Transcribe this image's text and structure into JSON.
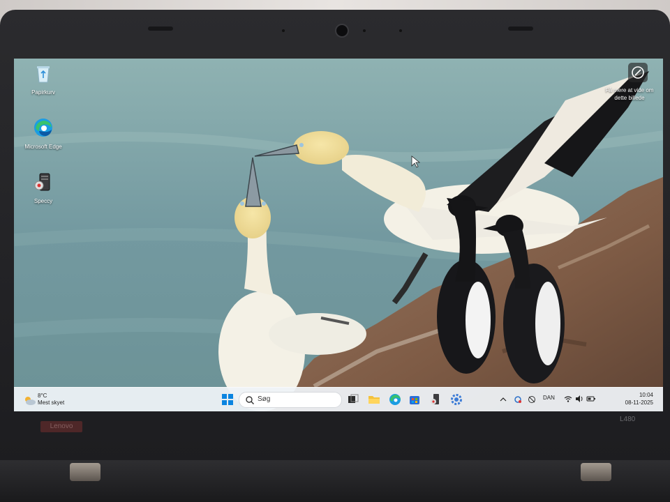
{
  "desktop": {
    "icons": [
      {
        "label": "Papirkurv",
        "icon": "recycle-bin-icon"
      },
      {
        "label": "Microsoft Edge",
        "icon": "edge-icon"
      },
      {
        "label": "Speccy",
        "icon": "speccy-icon"
      }
    ],
    "spotlight": {
      "label": "Få mere at vide om dette billede",
      "icon": "camera-lens-icon"
    }
  },
  "taskbar": {
    "weather": {
      "temperature": "8°C",
      "condition": "Mest skyet",
      "icon": "cloudy-icon"
    },
    "search": {
      "placeholder": "Søg",
      "icon": "search-icon"
    },
    "apps": [
      "start-icon",
      "task-view-icon",
      "file-explorer-icon",
      "edge-icon",
      "store-icon",
      "speccy-icon",
      "settings-icon"
    ],
    "tray": {
      "language": "DAN"
    },
    "clock": {
      "time": "10:04",
      "date": "08-11-2025"
    }
  },
  "hardware": {
    "brand": "Lenovo",
    "model": "L480"
  },
  "colors": {
    "taskbar": "#eef2f6",
    "sea": "#7a9da1",
    "accent": "#0078d4"
  }
}
